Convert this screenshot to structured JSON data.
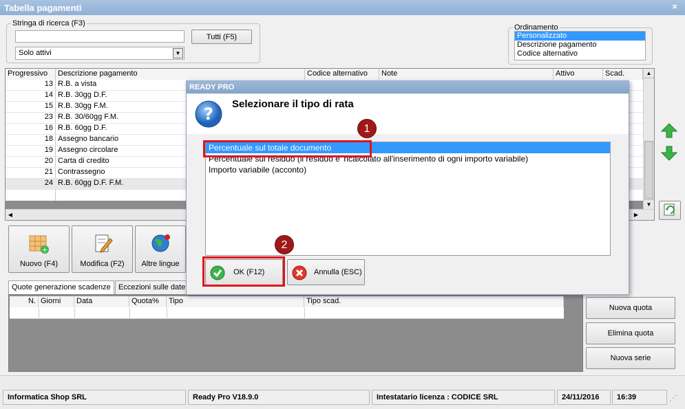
{
  "window": {
    "title": "Tabella pagamenti",
    "close": "×"
  },
  "search": {
    "legend": "Stringa di ricerca (F3)",
    "value": "",
    "all_button": "Tutti (F5)",
    "filter_value": "Solo attivi"
  },
  "sort": {
    "legend": "Ordinamento",
    "options": [
      "Personalizzato",
      "Descrizione pagamento",
      "Codice alternativo"
    ],
    "selected_index": 0
  },
  "grid": {
    "columns": [
      "Progressivo",
      "Descrizione pagamento",
      "Codice alternativo",
      "Note",
      "Attivo",
      "Scad."
    ],
    "rows": [
      {
        "num": "13",
        "desc": "R.B. a vista"
      },
      {
        "num": "14",
        "desc": "R.B. 30gg D.F."
      },
      {
        "num": "15",
        "desc": "R.B. 30gg F.M."
      },
      {
        "num": "23",
        "desc": "R.B. 30/60gg F.M."
      },
      {
        "num": "16",
        "desc": "R.B. 60gg D.F."
      },
      {
        "num": "18",
        "desc": "Assegno bancario"
      },
      {
        "num": "19",
        "desc": "Assegno circolare"
      },
      {
        "num": "20",
        "desc": "Carta di credito"
      },
      {
        "num": "21",
        "desc": "Contrassegno"
      },
      {
        "num": "24",
        "desc": "R.B. 60gg D.F. F.M."
      }
    ]
  },
  "toolbar": {
    "new": "Nuovo (F4)",
    "edit": "Modifica (F2)",
    "languages": "Altre lingue"
  },
  "tabs": [
    "Quote generazione scadenze",
    "Eccezioni sulle date"
  ],
  "quote_grid": {
    "columns": [
      "N.",
      "Giorni",
      "Data",
      "Quota%",
      "Tipo",
      "Tipo scad."
    ]
  },
  "quote_buttons": {
    "new_quota": "Nuova quota",
    "delete_quota": "Elimina quota",
    "new_series": "Nuova serie"
  },
  "dialog": {
    "title": "READY PRO",
    "question": "Selezionare il tipo di rata",
    "options": [
      "Percentuale sul totale documento",
      "Percentuale sul residuo (il residuo e' ricalcolato all'inserimento di ogni importo variabile)",
      "Importo variabile (acconto)"
    ],
    "selected_index": 0,
    "ok": "OK (F12)",
    "cancel": "Annulla (ESC)",
    "marker1": "1",
    "marker2": "2"
  },
  "status": {
    "company": "Informatica Shop SRL",
    "version": "Ready Pro V18.9.0",
    "license": "Intestatario licenza : CODICE SRL",
    "date": "24/11/2016",
    "time": "16:39"
  },
  "colors": {
    "selection": "#3399ff",
    "highlight_box": "#e0141e",
    "marker": "#a01818"
  }
}
